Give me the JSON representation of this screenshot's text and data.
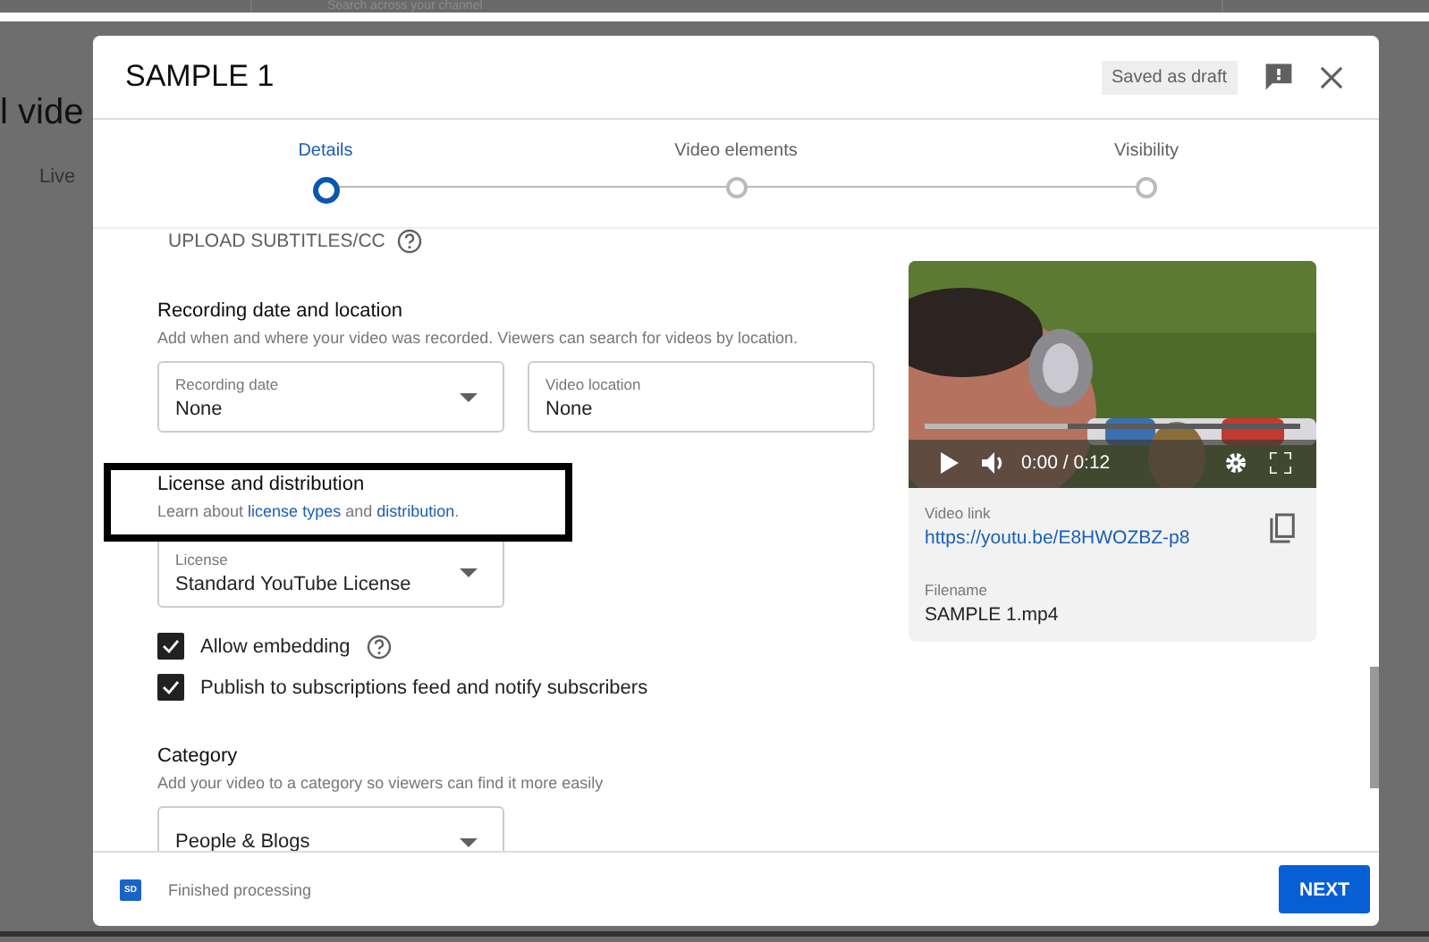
{
  "background": {
    "search_placeholder": "Search across your channel",
    "heading": "l vide",
    "tab": "Live"
  },
  "dialog": {
    "title": "SAMPLE 1",
    "draft_badge": "Saved as draft",
    "steps": [
      {
        "label": "Details",
        "selected": true
      },
      {
        "label": "Video elements",
        "selected": false
      },
      {
        "label": "Visibility",
        "selected": false
      }
    ],
    "subtitles_link": "UPLOAD SUBTITLES/CC",
    "recording": {
      "title": "Recording date and location",
      "description": "Add when and where your video was recorded. Viewers can search for videos by location.",
      "fields": [
        {
          "kind": "select",
          "label": "Recording date",
          "value": "None"
        },
        {
          "kind": "text",
          "label": "Video location",
          "value": "None"
        }
      ]
    },
    "license": {
      "title": "License and distribution",
      "description": [
        {
          "kind": "text",
          "text": "Learn about "
        },
        {
          "kind": "link",
          "text": "license types"
        },
        {
          "kind": "text",
          "text": " and "
        },
        {
          "kind": "link",
          "text": "distribution"
        },
        {
          "kind": "text",
          "text": "."
        }
      ],
      "field": {
        "kind": "select",
        "label": "License",
        "value": "Standard YouTube License"
      },
      "options": [
        {
          "label": "Allow embedding",
          "checked": true,
          "help": true
        },
        {
          "label": "Publish to subscriptions feed and notify subscribers",
          "checked": true,
          "help": false
        }
      ]
    },
    "category": {
      "title": "Category",
      "description": "Add your video to a category so viewers can find it more easily",
      "field": {
        "kind": "select",
        "value": "People & Blogs"
      }
    },
    "preview": {
      "time": "0:00 / 0:12",
      "progress": {
        "level": 0.38
      },
      "link_label": "Video link",
      "link": "https://youtu.be/E8HWOZBZ-p8",
      "filename_label": "Filename",
      "filename": "SAMPLE 1.mp4"
    },
    "footer": {
      "badge": "SD",
      "status": "Finished processing",
      "next_button": "NEXT"
    }
  },
  "annotation": {
    "kind": "rectangle"
  }
}
